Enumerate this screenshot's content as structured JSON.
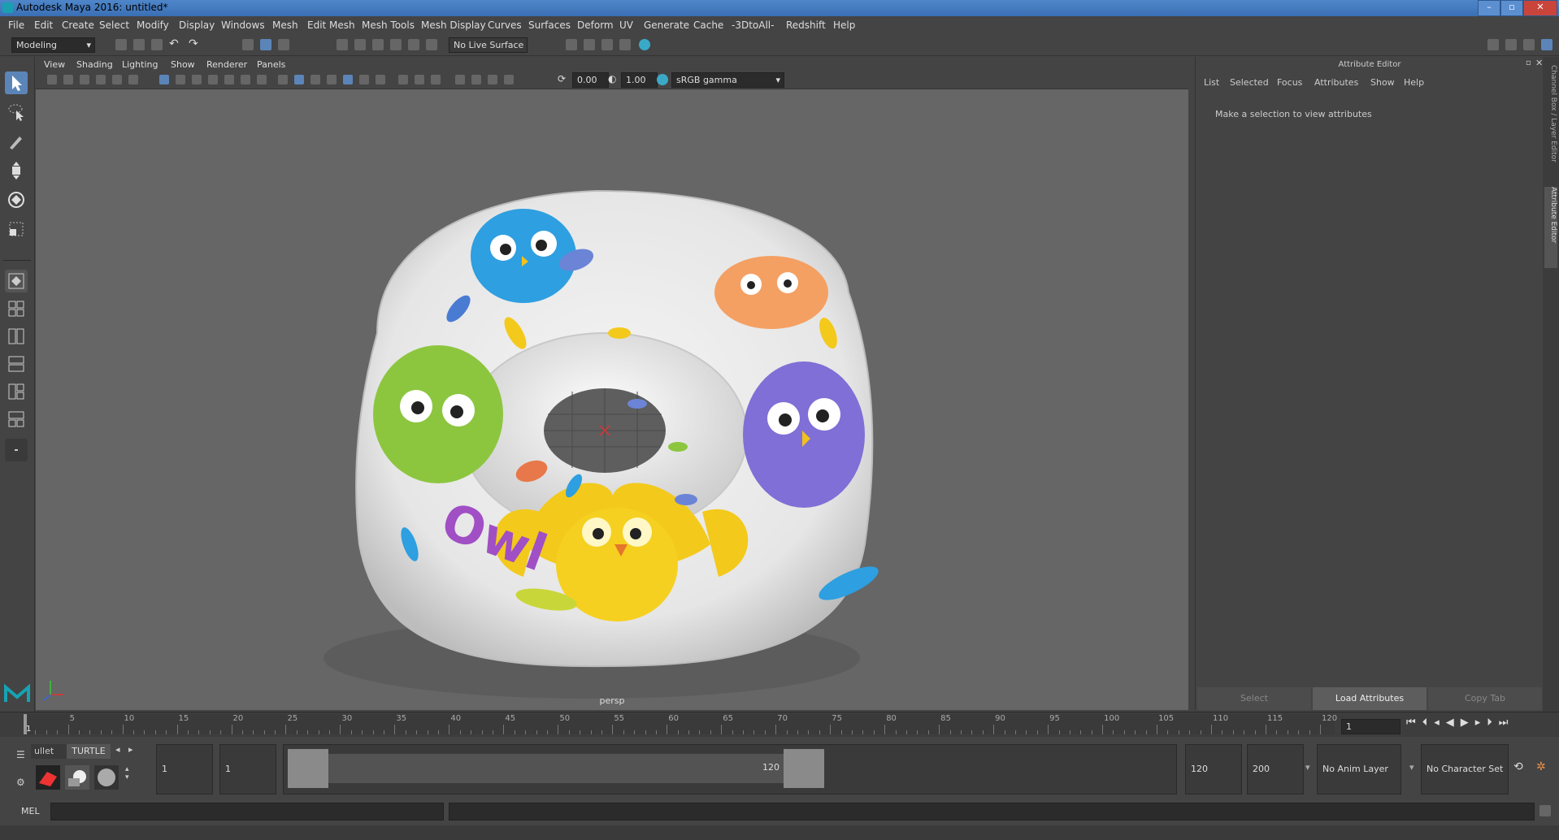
{
  "window": {
    "title": "Autodesk Maya 2016: untitled*"
  },
  "menus": [
    "File",
    "Edit",
    "Create",
    "Select",
    "Modify",
    "Display",
    "Windows",
    "Mesh",
    "Edit Mesh",
    "Mesh Tools",
    "Mesh Display",
    "Curves",
    "Surfaces",
    "Deform",
    "UV",
    "Generate",
    "Cache",
    "-3DtoAll-",
    "Redshift",
    "Help"
  ],
  "shelf": {
    "mode": "Modeling",
    "live_surface": "No Live Surface"
  },
  "viewport": {
    "menus": [
      "View",
      "Shading",
      "Lighting",
      "Show",
      "Renderer",
      "Panels"
    ],
    "exposure": "0.00",
    "gamma": "1.00",
    "colorspace": "sRGB gamma",
    "camera_label": "persp",
    "model_text": "Owl"
  },
  "attribute_editor": {
    "title": "Attribute Editor",
    "menus": [
      "List",
      "Selected",
      "Focus",
      "Attributes",
      "Show",
      "Help"
    ],
    "message": "Make a selection to view attributes",
    "buttons": [
      "Select",
      "Load Attributes",
      "Copy Tab"
    ],
    "side_tabs": [
      "Channel Box / Layer Editor",
      "Attribute Editor"
    ]
  },
  "timeline": {
    "ticks": [
      "1",
      "5",
      "10",
      "15",
      "20",
      "25",
      "30",
      "35",
      "40",
      "45",
      "50",
      "55",
      "60",
      "65",
      "70",
      "75",
      "80",
      "85",
      "90",
      "95",
      "100",
      "105",
      "110",
      "115",
      "120"
    ],
    "current_frame": "1"
  },
  "range": {
    "shelf_tabs": [
      "ullet",
      "TURTLE"
    ],
    "start": "1",
    "playback_start": "1",
    "slider_start": "1",
    "slider_end": "120",
    "playback_end": "120",
    "end": "200",
    "anim_layer": "No Anim Layer",
    "character_set": "No Character Set"
  },
  "command": {
    "lang": "MEL"
  }
}
